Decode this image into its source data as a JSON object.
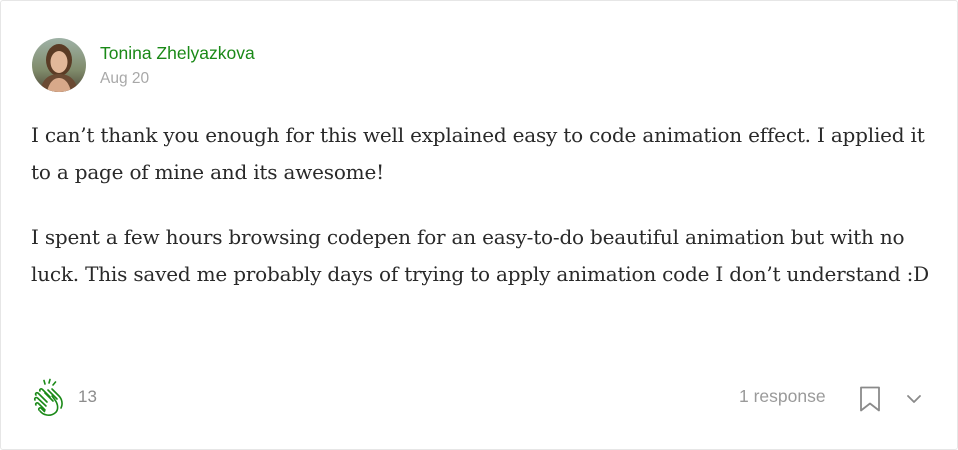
{
  "response": {
    "author_name": "Tonina Zhelyazkova",
    "date": "Aug 20",
    "paragraphs": [
      "I can’t thank you enough for this well explained easy to code animation effect. I applied it to a page of mine and its awesome!",
      "I spent a few hours browsing codepen for an easy-to-do beautiful animation but with no luck. This saved me probably days of trying to apply animation code I don’t understand :D"
    ]
  },
  "footer": {
    "clap_count": "13",
    "responses_label": "1 response"
  },
  "icons": {
    "clap": "clap-icon",
    "bookmark": "bookmark-icon",
    "more": "chevron-down-icon"
  },
  "colors": {
    "accent": "#1a8917",
    "muted": "#a8a8a8",
    "text": "#292929"
  }
}
